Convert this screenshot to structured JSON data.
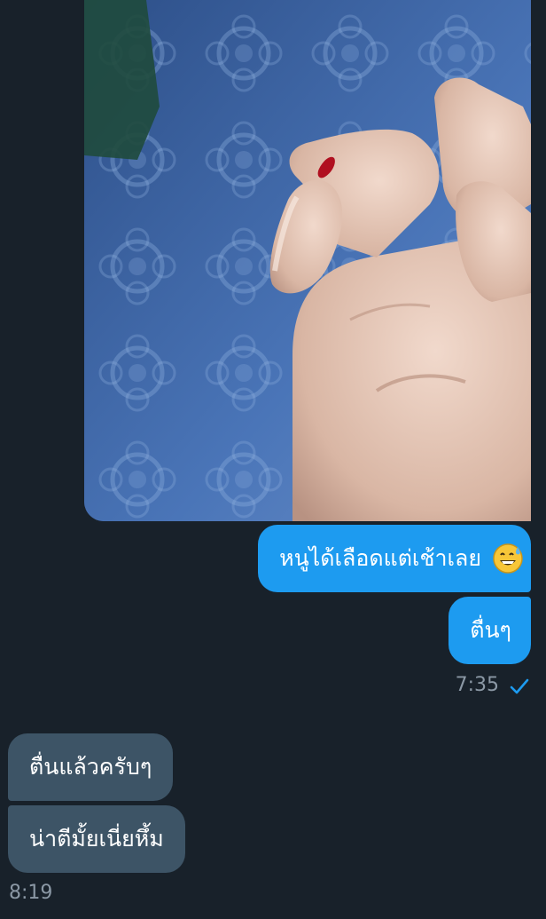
{
  "messages": {
    "outgoing": {
      "photo_icon": "hand-with-bleeding-finger-photo",
      "text_1": "หนูได้เลือดแต่เช้าเลย",
      "text_1_emoji": "grinning-face-with-sweat-emoji",
      "text_2": "ตื่นๆ",
      "time": "7:35",
      "status_icon": "check-icon"
    },
    "incoming": {
      "text_1": "ตื่นแล้วครับๆ",
      "text_2": "น่าตีมั้ยเนี่ยหึ้ม",
      "time": "8:19"
    }
  },
  "colors": {
    "background": "#18212a",
    "outgoing_bubble": "#1d9bf0",
    "incoming_bubble": "#3d5466",
    "timestamp": "#8b98a5"
  }
}
